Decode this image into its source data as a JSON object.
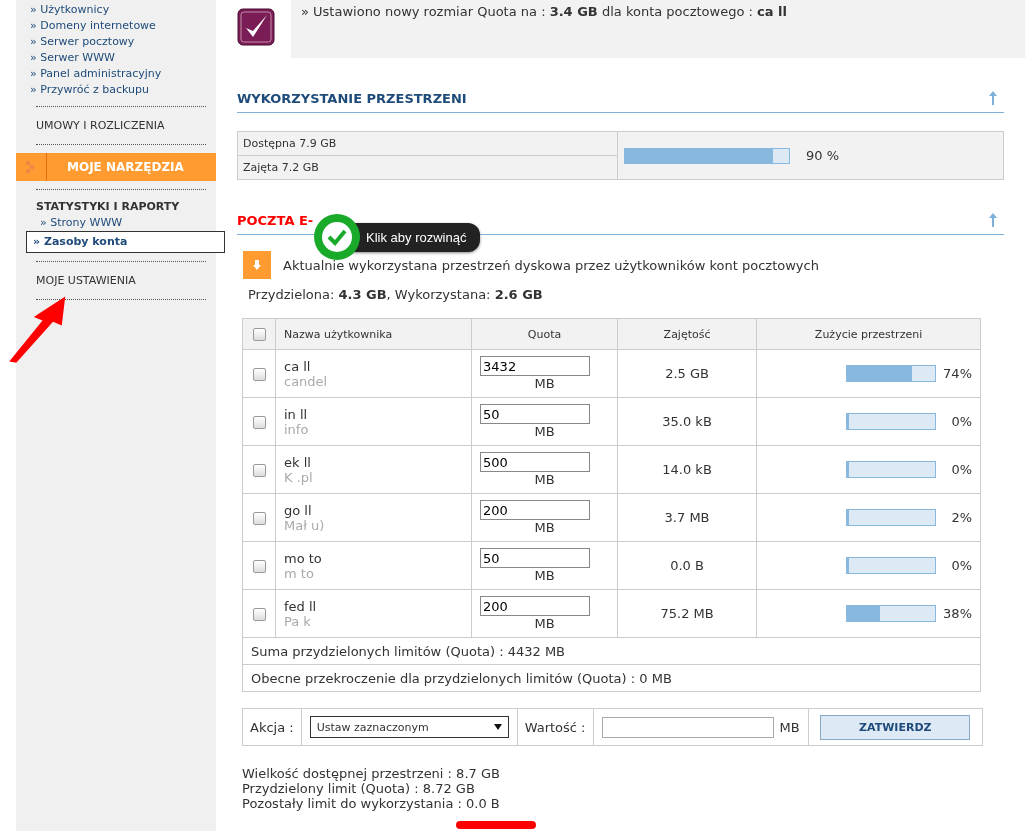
{
  "sidebar": {
    "links": [
      {
        "label": "» Użytkownicy",
        "selected": false
      },
      {
        "label": "» Domeny internetowe",
        "selected": false
      },
      {
        "label": "» Serwer pocztowy",
        "selected": false
      },
      {
        "label": "» Serwer WWW",
        "selected": false
      },
      {
        "label": "» Panel administracyjny",
        "selected": false
      },
      {
        "label": "» Przywróć z backupu",
        "selected": false
      }
    ],
    "sections": [
      {
        "kind": "link",
        "label": "UMOWY I ROZLICZENIA"
      },
      {
        "kind": "active",
        "label": "MOJE NARZĘDZIA"
      },
      {
        "kind": "group",
        "title": "STATYSTYKI I RAPORTY",
        "links": [
          {
            "label": "» Strony WWW",
            "selected": false
          },
          {
            "label": "» Zasoby konta",
            "selected": true
          }
        ]
      },
      {
        "kind": "link",
        "label": "MOJE USTAWIENIA"
      }
    ]
  },
  "notice": {
    "text": "» Ustawiono nowy rozmiar Quota na : **3.4 GB** dla konta pocztowego : **ca ll**"
  },
  "usage": {
    "title": "WYKORZYSTANIE PRZESTRZENI",
    "rows": [
      "Dostępna 7.9 GB",
      "Zajęta 7.2 GB"
    ],
    "level": 0.9,
    "reading": "90 %"
  },
  "mail": {
    "title": "POCZTA E-",
    "expand_text": "Aktualnie wykorzystana przestrzeń dyskowa przez użytkowników kont pocztowych",
    "summary": "Przydzielona: **4.3 GB**, Wykorzystana: **2.6 GB**",
    "columns": [
      "Nazwa użytkownika",
      "Quota",
      "Zajętość",
      "Zużycie przestrzeni"
    ],
    "select_all_checked": false,
    "rows": [
      {
        "name": "ca ll",
        "sub": "candel",
        "quota": "3432",
        "unit": "MB",
        "used": "2.5 GB",
        "level": 0.74,
        "reading": "74%",
        "checked": false
      },
      {
        "name": "in ll",
        "sub": "info",
        "quota": "50",
        "unit": "MB",
        "used": "35.0 kB",
        "level": 0.0,
        "reading": "0%",
        "checked": false
      },
      {
        "name": "ek ll",
        "sub": "K .pl",
        "quota": "500",
        "unit": "MB",
        "used": "14.0 kB",
        "level": 0.0,
        "reading": "0%",
        "checked": false
      },
      {
        "name": "go ll",
        "sub": "Mał u)",
        "quota": "200",
        "unit": "MB",
        "used": "3.7 MB",
        "level": 0.02,
        "reading": "2%",
        "checked": false
      },
      {
        "name": "mo to",
        "sub": "m to",
        "quota": "50",
        "unit": "MB",
        "used": "0.0 B",
        "level": 0.0,
        "reading": "0%",
        "checked": false
      },
      {
        "name": "fed ll",
        "sub": "Pa k",
        "quota": "200",
        "unit": "MB",
        "used": "75.2 MB",
        "level": 0.38,
        "reading": "38%",
        "checked": false
      }
    ],
    "totals": [
      "Suma przydzielonych limitów (Quota) : 4432 MB",
      "Obecne przekroczenie dla przydzielonych limitów (Quota) : 0 MB"
    ],
    "action": {
      "label": "Akcja :",
      "select": "Ustaw zaznaczonym",
      "value_label": "Wartość :",
      "unit": "MB",
      "button": "ZATWIERDZ"
    },
    "footer": [
      "Wielkość dostępnej przestrzeni : 8.7 GB",
      "Przydzielony limit (Quota) : 8.72 GB",
      "Pozostały limit do wykorzystania : 0.0 B"
    ]
  },
  "tooltip": {
    "text": "Klik aby rozwinąć"
  }
}
